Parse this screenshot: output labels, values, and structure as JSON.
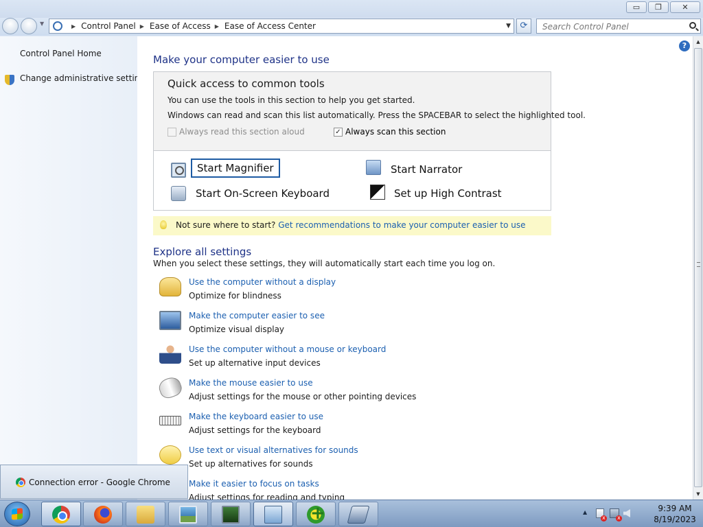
{
  "window": {
    "controls": {
      "minimize": "▭",
      "maximize": "❐",
      "close": "✕"
    }
  },
  "address": {
    "crumbs": [
      "Control Panel",
      "Ease of Access",
      "Ease of Access Center"
    ],
    "search_placeholder": "Search Control Panel"
  },
  "left_pane": {
    "home": "Control Panel Home",
    "admin": "Change administrative settings"
  },
  "main": {
    "heading": "Make your computer easier to use",
    "quick_access": {
      "title": "Quick access to common tools",
      "line1": "You can use the tools in this section to help you get started.",
      "line2": "Windows can read and scan this list automatically.  Press the SPACEBAR to select the highlighted tool.",
      "read_aloud": {
        "label": "Always read this section aloud",
        "checked": false,
        "enabled": false
      },
      "scan": {
        "label": "Always scan this section",
        "checked": true,
        "enabled": true
      },
      "tools": {
        "magnifier": "Start Magnifier",
        "narrator": "Start Narrator",
        "keyboard": "Start On-Screen Keyboard",
        "contrast": "Set up High Contrast"
      }
    },
    "hint": {
      "text": "Not sure where to start?",
      "link": "Get recommendations to make your computer easier to use"
    },
    "explore": {
      "heading": "Explore all settings",
      "sub": "When you select these settings, they will automatically start each time you log on.",
      "items": [
        {
          "link": "Use the computer without a display",
          "desc": "Optimize for blindness",
          "icon": "display-icon"
        },
        {
          "link": "Make the computer easier to see",
          "desc": "Optimize visual display",
          "icon": "monitor-icon"
        },
        {
          "link": "Use the computer without a mouse or keyboard",
          "desc": "Set up alternative input devices",
          "icon": "person-icon"
        },
        {
          "link": "Make the mouse easier to use",
          "desc": "Adjust settings for the mouse or other pointing devices",
          "icon": "mouse-icon"
        },
        {
          "link": "Make the keyboard easier to use",
          "desc": "Adjust settings for the keyboard",
          "icon": "keyboard-icon"
        },
        {
          "link": "Use text or visual alternatives for sounds",
          "desc": "Set up alternatives for sounds",
          "icon": "speech-bubble-icon"
        },
        {
          "link": "Make it easier to focus on tasks",
          "desc": "Adjust settings for reading and typing",
          "icon": "focus-icon"
        }
      ]
    }
  },
  "popup": {
    "text": "Connection error - Google Chrome"
  },
  "taskbar": {
    "apps": [
      "chrome",
      "firefox",
      "file-explorer",
      "photo-viewer",
      "system-monitor",
      "control-panel",
      "plus-app",
      "drive-app"
    ],
    "time": "9:39 AM",
    "date": "8/19/2023"
  }
}
